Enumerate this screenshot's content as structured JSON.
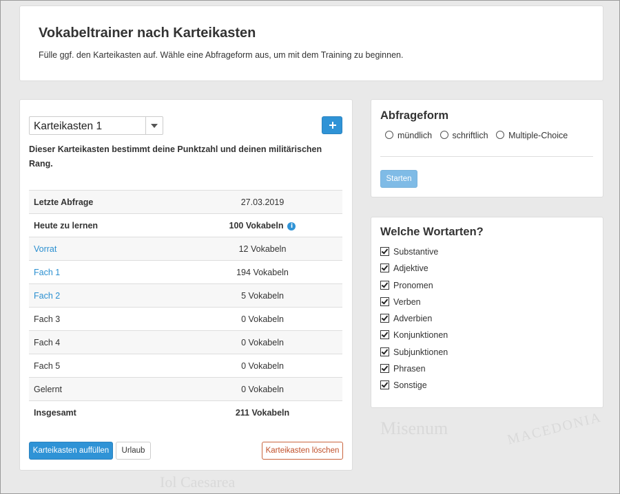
{
  "header": {
    "title": "Vokabeltrainer nach Karteikasten",
    "subtitle": "Fülle ggf. den Karteikasten auf. Wähle eine Abfrageform aus, um mit dem Training zu beginnen."
  },
  "karteikasten": {
    "selected": "Karteikasten 1",
    "description": "Dieser Karteikasten bestimmt deine Punktzahl und deinen militärischen Rang.",
    "rows": [
      {
        "label": "Letzte Abfrage",
        "value": "27.03.2019"
      },
      {
        "label": "Heute zu lernen",
        "value": "100 Vokabeln"
      },
      {
        "label": "Vorrat",
        "value": "12 Vokabeln"
      },
      {
        "label": "Fach 1",
        "value": "194 Vokabeln"
      },
      {
        "label": "Fach 2",
        "value": "5 Vokabeln"
      },
      {
        "label": "Fach 3",
        "value": "0 Vokabeln"
      },
      {
        "label": "Fach 4",
        "value": "0 Vokabeln"
      },
      {
        "label": "Fach 5",
        "value": "0 Vokabeln"
      },
      {
        "label": "Gelernt",
        "value": "0 Vokabeln"
      },
      {
        "label": "Insgesamt",
        "value": "211 Vokabeln"
      }
    ],
    "buttons": {
      "fill": "Karteikasten auffüllen",
      "vacation": "Urlaub",
      "delete": "Karteikasten löschen"
    }
  },
  "abfrageform": {
    "title": "Abfrageform",
    "options": [
      "mündlich",
      "schriftlich",
      "Multiple-Choice"
    ],
    "start": "Starten"
  },
  "wortarten": {
    "title": "Welche Wortarten?",
    "items": [
      "Substantive",
      "Adjektive",
      "Pronomen",
      "Verben",
      "Adverbien",
      "Konjunktionen",
      "Subjunktionen",
      "Phrasen",
      "Sonstige"
    ]
  },
  "background_map_text": [
    "Misenum",
    "MACEDONIA",
    "Iol Caesarea"
  ],
  "colors": {
    "primary": "#2f93d6",
    "link": "#2a8fd0",
    "danger": "#c0502a",
    "disabled": "#7fbbe6"
  },
  "icons": {
    "add": "plus-icon",
    "info": "info-icon",
    "dropdown": "chevron-down-icon"
  }
}
